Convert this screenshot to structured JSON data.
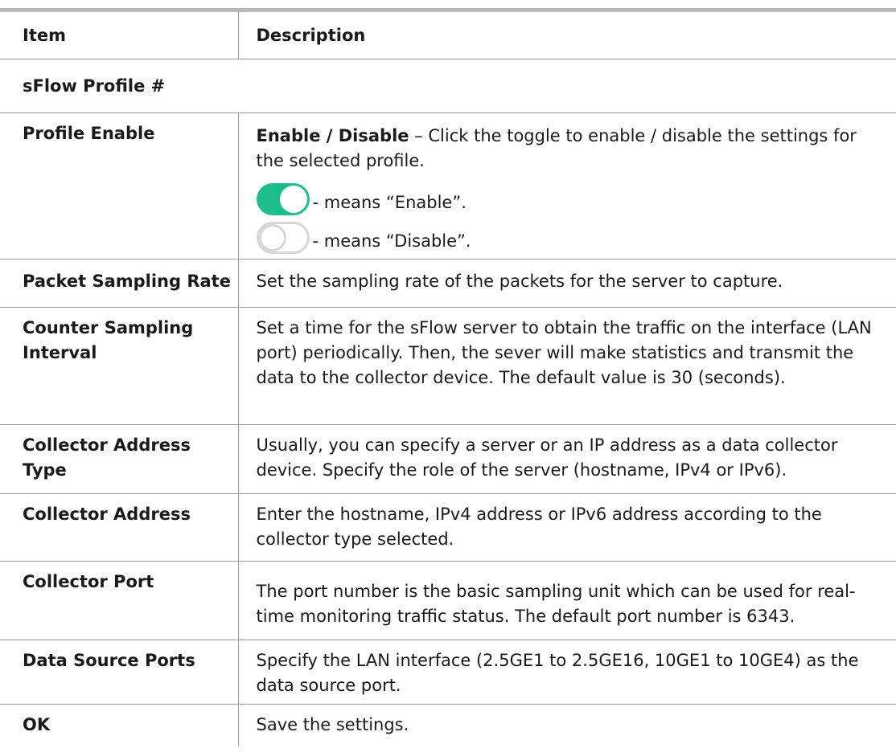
{
  "table": {
    "header": {
      "item": "Item",
      "description": "Description"
    },
    "section_title": "sFlow Profile #",
    "profile_enable": {
      "item": "Profile Enable",
      "desc_bold": "Enable / Disable",
      "desc_rest": " – Click the toggle to enable / disable the settings for the selected profile.",
      "toggle_on_text": "- means “Enable”.",
      "toggle_off_text": "- means “Disable”."
    },
    "rows": [
      {
        "item": "Packet Sampling Rate",
        "description": "Set the sampling rate of the packets for the server to capture."
      },
      {
        "item": "Counter Sampling Interval",
        "description": "Set a time for the sFlow server to obtain the traffic on the interface (LAN port) periodically. Then, the sever will make statistics and transmit the data to the collector device. The default value is 30 (seconds)."
      },
      {
        "item": "Collector Address Type",
        "description": "Usually, you can specify a server or an IP address as a data collector device. Specify the role of the server (hostname, IPv4 or IPv6)."
      },
      {
        "item": "Collector Address",
        "description": "Enter the hostname, IPv4 address or IPv6 address according to the collector type selected."
      },
      {
        "item": "Collector Port",
        "description": "The port number is the basic sampling unit which can be used for real-time monitoring traffic status. The default port number is 6343."
      },
      {
        "item": "Data Source Ports",
        "description": "Specify the LAN interface (2.5GE1 to 2.5GE16, 10GE1 to 10GE4) as the data source port."
      },
      {
        "item": "OK",
        "description": "Save the settings."
      }
    ]
  },
  "colors": {
    "toggle_on": "#1cbf8c",
    "toggle_off_border": "#d7d7d7",
    "rule": "#9a9a9a",
    "top_rule": "#b8b8b8"
  }
}
